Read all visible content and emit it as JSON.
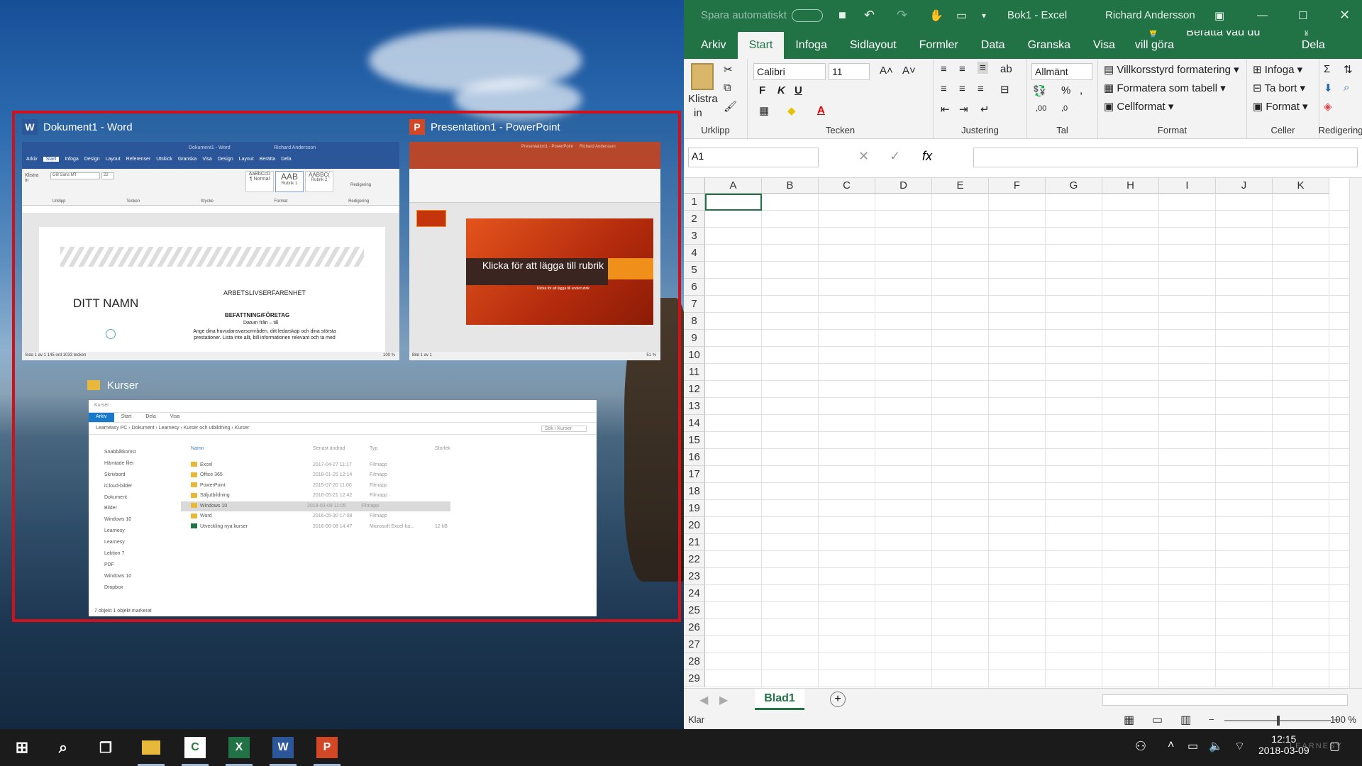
{
  "colors": {
    "word": "#2b579a",
    "powerpoint": "#d24726",
    "excel": "#217346",
    "snap_border": "#d0101b"
  },
  "snap": {
    "word": {
      "title": "Dokument1 - Word",
      "icon": "word-icon",
      "titlebar": "Dokument1 - Word",
      "user": "Richard Andersson",
      "tabs": [
        "Arkiv",
        "Start",
        "Infoga",
        "Design",
        "Layout",
        "Referenser",
        "Utskick",
        "Granska",
        "Visa",
        "Design",
        "Layout",
        "Berätta",
        "Dela"
      ],
      "font": "Gill Sans MT",
      "size": "22",
      "styles": [
        "AaBbCcD",
        "AAB",
        "AABBC("
      ],
      "style_names": [
        "¶ Normal",
        "Rubrik 1",
        "Rubrik 2"
      ],
      "groups": [
        "Urklipp",
        "Tecken",
        "Stycke",
        "Format",
        "Redigering"
      ],
      "paste": "Klistra in",
      "editing": "Redigering",
      "doc": {
        "name": "DITT NAMN",
        "heading": "ARBETSLIVSERFARENHET",
        "role": "BEFATTNING/FÖRETAG",
        "dates": "Datum från – till",
        "body": "Ange dina huvudansvarsområden, ditt ledarskap och dina största prestationer. Lista inte allt, bill informationen relevant och ta med"
      },
      "status": "Sida 1 av 1     145 ord     1033 tecken",
      "zoom": "100 %"
    },
    "powerpoint": {
      "title": "Presentation1 - PowerPoint",
      "icon": "powerpoint-icon",
      "titlebar": "Presentation1 - PowerPoint",
      "user": "Richard Andersson",
      "slide_title": "Klicka för att lägga till rubrik",
      "slide_sub": "Klicka för att lägga till underrubrik",
      "status": "Bild 1 av 1",
      "zoom": "51 %"
    },
    "explorer": {
      "title": "Kurser",
      "icon": "folder-icon",
      "tabs": [
        "Arkiv",
        "Start",
        "Dela",
        "Visa"
      ],
      "path": "Learneasy PC  ›  Dokument  ›  Learnesy  ›  Kurser och utbildning  ›  Kurser",
      "search": "Sök i Kurser",
      "nav": [
        "Snabbåtkomst",
        "Hämtade filer",
        "Skrivbord",
        "iCloud-bilder",
        "Dokument",
        "Bilder",
        "Windows 10",
        "Learnesy",
        "Learnesy",
        "Lektion 7",
        "PDF",
        "Windows 10",
        "Dropbox"
      ],
      "columns": [
        "Namn",
        "Senast ändrad",
        "Typ",
        "Storlek"
      ],
      "rows": [
        [
          "Excel",
          "2017-04-27 11:17",
          "Filmapp",
          ""
        ],
        [
          "Office 365",
          "2018-01-25 12:14",
          "Filmapp",
          ""
        ],
        [
          "PowerPoint",
          "2015-07-20 11:00",
          "Filmapp",
          ""
        ],
        [
          "Säljutbildning",
          "2016-05-21 12:42",
          "Filmapp",
          ""
        ],
        [
          "Windows 10",
          "2018-03-09 11:05",
          "Filmapp",
          ""
        ],
        [
          "Word",
          "2016-05-30 17:08",
          "Filmapp",
          ""
        ],
        [
          "Utveckling nya kurser",
          "2016-06-08 14:47",
          "Microsoft Excel-ka...",
          "12 kB"
        ]
      ],
      "selected_row": 4,
      "status": "7 objekt     1 objekt markerat"
    }
  },
  "excel": {
    "autosave": "Spara automatiskt",
    "title": "Bok1  -  Excel",
    "user": "Richard Andersson",
    "tabs": [
      "Arkiv",
      "Start",
      "Infoga",
      "Sidlayout",
      "Formler",
      "Data",
      "Granska",
      "Visa"
    ],
    "tell": "Berätta vad du vill göra",
    "share": "Dela",
    "font": "Calibri",
    "size": "11",
    "number_format": "Allmänt",
    "paste": "Klistra",
    "paste2": "in",
    "bold": "F",
    "italic": "K",
    "underline": "U",
    "styles": [
      "Villkorsstyrd formatering",
      "Formatera som tabell",
      "Cellformat"
    ],
    "cells": [
      "Infoga",
      "Ta bort",
      "Format"
    ],
    "groups": [
      "Urklipp",
      "Tecken",
      "Justering",
      "Tal",
      "Format",
      "Celler",
      "Redigering"
    ],
    "namebox": "A1",
    "fx": "fx",
    "columns": [
      "A",
      "B",
      "C",
      "D",
      "E",
      "F",
      "G",
      "H",
      "I",
      "J",
      "K"
    ],
    "rows": [
      "1",
      "2",
      "3",
      "4",
      "5",
      "6",
      "7",
      "8",
      "9",
      "10",
      "11",
      "12",
      "13",
      "14",
      "15",
      "16",
      "17",
      "18",
      "19",
      "20",
      "21",
      "22",
      "23",
      "24",
      "25",
      "26",
      "27",
      "28",
      "29"
    ],
    "sheet": "Blad1",
    "status": "Klar",
    "zoom": "100 %"
  },
  "taskbar": {
    "time": "12:15",
    "date": "2018-03-09",
    "watermark": "LEARNESY"
  }
}
